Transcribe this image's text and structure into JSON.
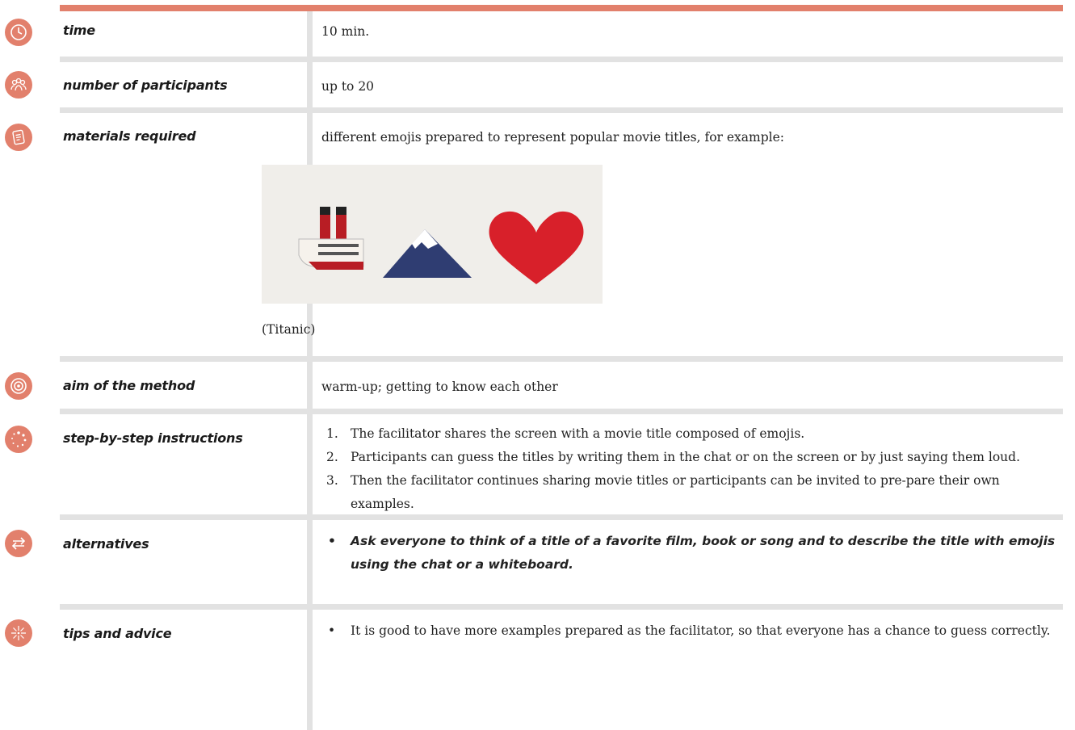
{
  "rows": {
    "time": {
      "label": "time",
      "value": "10 min.",
      "icon": "clock-icon"
    },
    "participants": {
      "label": "number of participants",
      "value": "up to 20",
      "icon": "people-icon"
    },
    "materials": {
      "label": "materials required",
      "value": "different emojis prepared to represent popular movie titles, for example:",
      "caption": "(Titanic)",
      "icon": "notes-icon",
      "emojis": [
        "ship-emoji",
        "mountain-emoji",
        "heart-emoji"
      ]
    },
    "aim": {
      "label": "aim of the method",
      "value": "warm-up; getting to know each other",
      "icon": "target-icon"
    },
    "steps": {
      "label": "step-by-step instructions",
      "icon": "dots-circle-icon",
      "items": [
        {
          "num": "1.",
          "text": "The facilitator shares the screen with a movie title composed of emojis."
        },
        {
          "num": "2.",
          "text": "Participants can guess the titles by writing them in the chat or on the screen or by just saying them loud."
        },
        {
          "num": "3.",
          "text": "Then the facilitator continues sharing movie titles or participants can be invited to pre-pare their own examples."
        }
      ]
    },
    "alternatives": {
      "label": "alternatives",
      "icon": "arrows-icon",
      "bullet": "•",
      "items": [
        "Ask everyone to think of a title of a favorite film, book or song and to describe the title with emojis using the chat or a whiteboard."
      ]
    },
    "tips": {
      "label": "tips and advice",
      "icon": "spark-icon",
      "bullet": "•",
      "items": [
        "It is good to have more examples prepared as the facilitator, so that everyone has a chance to guess correctly."
      ]
    }
  },
  "colors": {
    "accent": "#e2806c",
    "divider": "#e2e2e2"
  }
}
